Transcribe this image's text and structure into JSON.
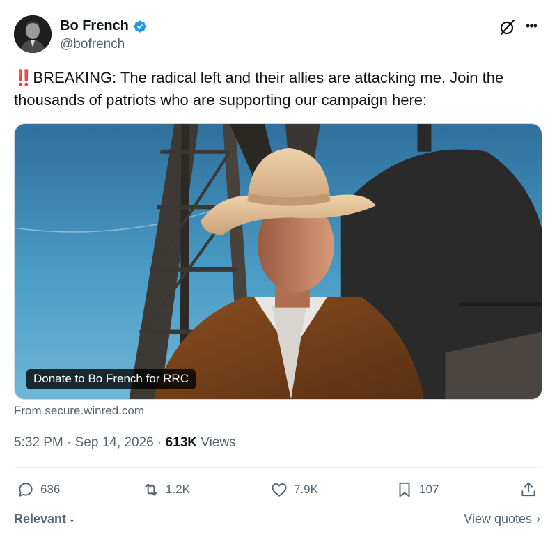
{
  "author": {
    "display_name": "Bo French",
    "handle": "@bofrench",
    "verified": true,
    "verified_color": "#1d9bf0"
  },
  "tweet": {
    "alert_prefix": "‼️",
    "text": "BREAKING: The radical left and their allies are attacking me. Join the thousands of patriots who are supporting our campaign here:"
  },
  "card": {
    "label": "Donate to Bo French for RRC",
    "source": "From secure.winred.com"
  },
  "meta": {
    "time": "5:32 PM",
    "separator": "·",
    "date": "Sep 14, 2026",
    "views_count": "613K",
    "views_label": "Views"
  },
  "actions": {
    "replies": "636",
    "reposts": "1.2K",
    "likes": "7.9K",
    "bookmarks": "107"
  },
  "footer": {
    "sort_label": "Relevant",
    "view_quotes": "View quotes"
  },
  "icons": {
    "header": [
      "grok-icon",
      "more-icon"
    ],
    "actions": [
      "reply-icon",
      "repost-icon",
      "like-icon",
      "bookmark-icon",
      "share-icon"
    ]
  }
}
